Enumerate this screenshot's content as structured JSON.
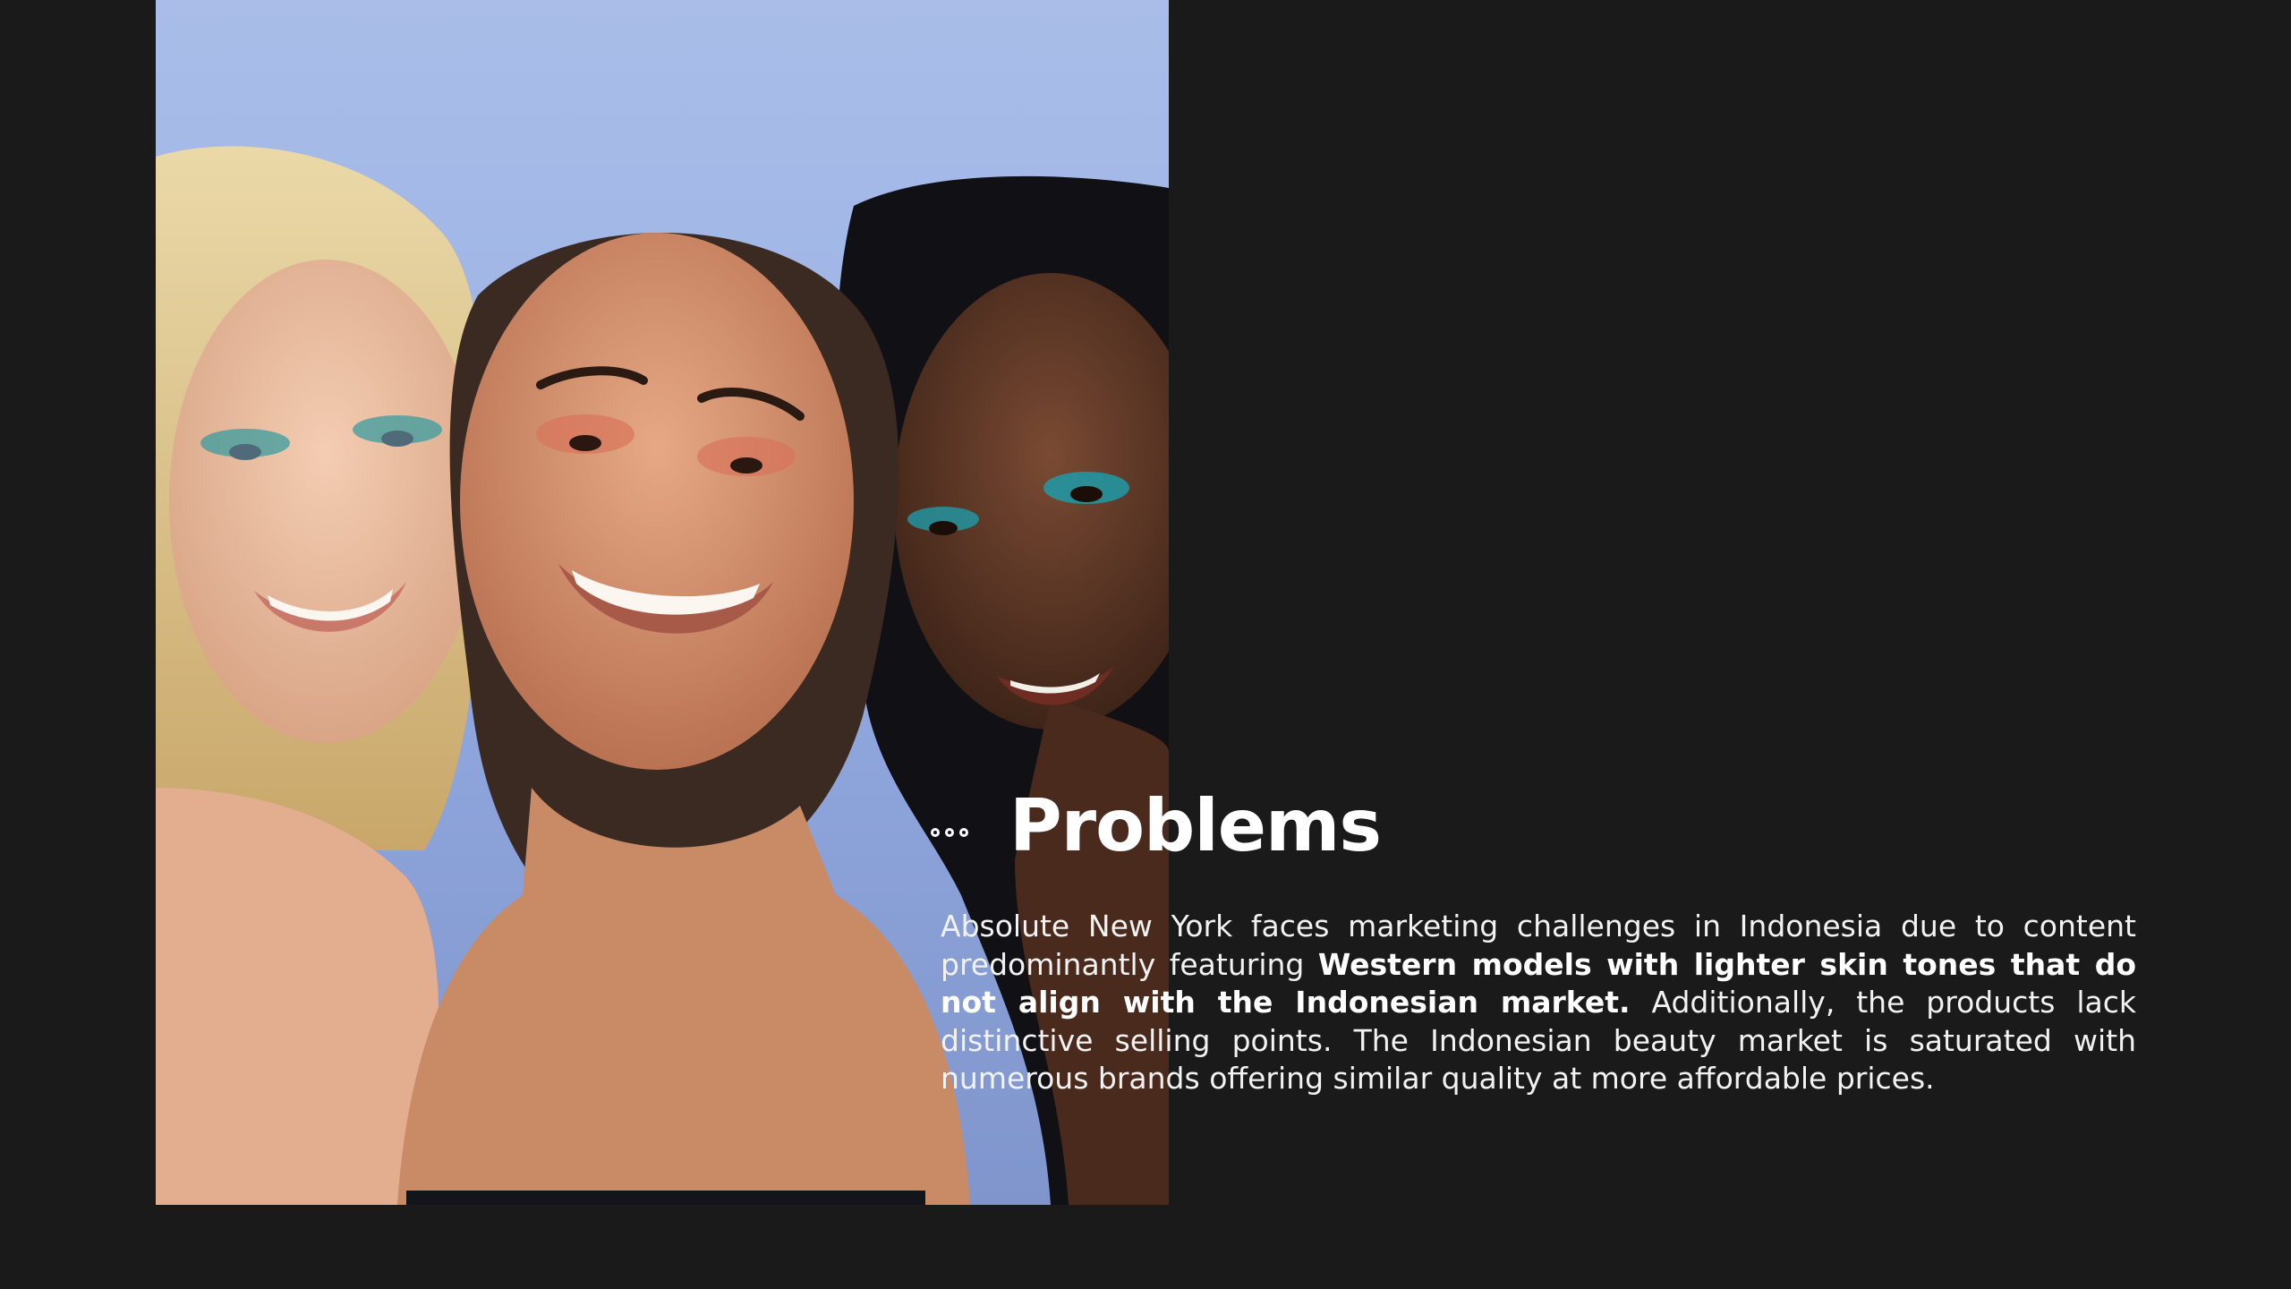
{
  "slide": {
    "title": "Problems",
    "title_marker_icon": "three-dots-icon",
    "paragraph": {
      "part1": "Absolute New York faces marketing challenges in Indonesia due to content predominantly featuring ",
      "bold": "Western models with lighter skin tones that do not align with the Indonesian market.",
      "part2": " Additionally, the products lack distinctive selling points. The Indonesian beauty market is saturated with numerous brands offering similar quality at more affordable prices."
    }
  },
  "colors": {
    "background": "#1a1a1a",
    "text": "#ffffff",
    "photo_backdrop": "#a3b9e6"
  }
}
